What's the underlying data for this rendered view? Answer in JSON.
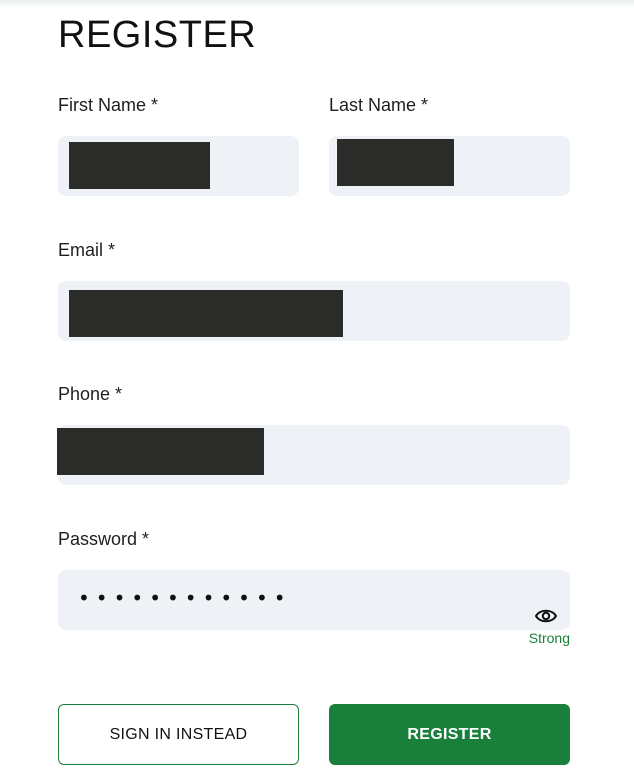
{
  "form": {
    "title": "REGISTER",
    "fields": {
      "first_name": {
        "label": "First Name *",
        "value": "[redacted]"
      },
      "last_name": {
        "label": "Last Name *",
        "value": "[redacted]"
      },
      "email": {
        "label": "Email *",
        "value": "[redacted]"
      },
      "phone": {
        "label": "Phone *",
        "value": "[redacted]"
      },
      "password": {
        "label": "Password *",
        "masked_value": "••••••••••••",
        "strength": "Strong",
        "toggle_icon": "eye-icon"
      }
    },
    "buttons": {
      "sign_in": "SIGN IN INSTEAD",
      "register": "REGISTER"
    }
  },
  "colors": {
    "accent": "#18803b",
    "input_bg": "#eef2f6",
    "strength_text": "#1a7f3a"
  }
}
